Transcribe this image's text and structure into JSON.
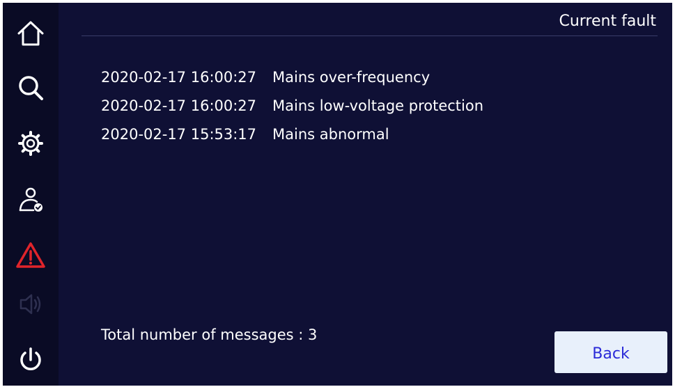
{
  "header": {
    "title": "Current fault"
  },
  "sidebar": {
    "items": [
      {
        "name": "home",
        "icon": "home-icon"
      },
      {
        "name": "search",
        "icon": "search-icon"
      },
      {
        "name": "settings",
        "icon": "gear-icon"
      },
      {
        "name": "user",
        "icon": "user-check-icon"
      },
      {
        "name": "alarm",
        "icon": "warning-icon",
        "active": true
      },
      {
        "name": "sound",
        "icon": "speaker-icon",
        "disabled": true
      },
      {
        "name": "power",
        "icon": "power-icon"
      }
    ]
  },
  "faults": [
    {
      "time": "2020-02-17 16:00:27",
      "message": "Mains over-frequency"
    },
    {
      "time": "2020-02-17 16:00:27",
      "message": "Mains low-voltage protection"
    },
    {
      "time": "2020-02-17 15:53:17",
      "message": "Mains abnormal"
    }
  ],
  "footer": {
    "total_label": "Total number of messages : 3",
    "back_label": "Back"
  },
  "colors": {
    "background": "#0f1035",
    "sidebar": "#0a0b25",
    "icon": "#ffffff",
    "alarm_active": "#e0242b",
    "disabled_icon": "#2e3050",
    "back_button_bg": "#e8f0fb",
    "back_button_text": "#2a2ad8"
  }
}
